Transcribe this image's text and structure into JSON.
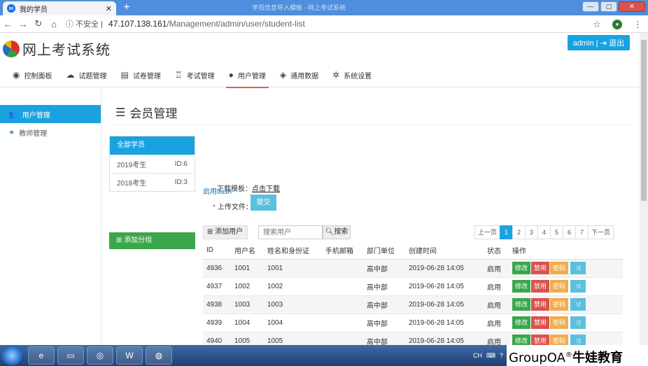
{
  "browser": {
    "tab_title": "我的学员",
    "window_title": "学员信息导入模板 - 网上考试系统",
    "url_warning": "不安全",
    "url_host": "47.107.138.161",
    "url_path": "/Management/admin/user/student-list"
  },
  "header": {
    "app_title": "网上考试系统",
    "admin_label": "admin",
    "logout_label": "退出"
  },
  "main_nav": [
    {
      "label": "控制面板",
      "icon": "dashboard-icon"
    },
    {
      "label": "试题管理",
      "icon": "cloud-icon"
    },
    {
      "label": "试卷管理",
      "icon": "file-icon"
    },
    {
      "label": "考试管理",
      "icon": "trophy-icon"
    },
    {
      "label": "用户管理",
      "icon": "user-icon",
      "active": true
    },
    {
      "label": "通用数据",
      "icon": "cubes-icon"
    },
    {
      "label": "系统设置",
      "icon": "gear-icon"
    }
  ],
  "sidebar": {
    "items": [
      {
        "label": "用户管理",
        "active": true
      },
      {
        "label": "教师管理",
        "active": false
      }
    ]
  },
  "content": {
    "heading": "会员管理",
    "groups": {
      "header": "全部学员",
      "rows": [
        {
          "name": "2019考生",
          "id": "ID:6"
        },
        {
          "name": "2018考生",
          "id": "ID:3"
        }
      ],
      "add_label": "添加分组"
    },
    "upload": {
      "template_label": "下载模板：",
      "template_link": "点击下载",
      "file_label": "上传文件：",
      "flash_link": "启用flash",
      "submit_label": "提交"
    },
    "toolbar": {
      "add_user": "添加用户",
      "search_placeholder": "搜索用户",
      "search_button": "搜索"
    },
    "pager": [
      "上一页",
      "1",
      "2",
      "3",
      "4",
      "5",
      "6",
      "7",
      "下一页"
    ],
    "table": {
      "headers": [
        "ID",
        "用户名",
        "姓名和身份证",
        "手机邮箱",
        "部门单位",
        "创建时间",
        "状态",
        "操作"
      ],
      "rows": [
        {
          "id": "4936",
          "username": "1001",
          "name": "1001",
          "contact": "",
          "dept": "高中部",
          "created": "2019-06-28 14:05",
          "status": "启用"
        },
        {
          "id": "4937",
          "username": "1002",
          "name": "1002",
          "contact": "",
          "dept": "高中部",
          "created": "2019-06-28 14:05",
          "status": "启用"
        },
        {
          "id": "4938",
          "username": "1003",
          "name": "1003",
          "contact": "",
          "dept": "高中部",
          "created": "2019-06-28 14:05",
          "status": "启用"
        },
        {
          "id": "4939",
          "username": "1004",
          "name": "1004",
          "contact": "",
          "dept": "高中部",
          "created": "2019-06-28 14:05",
          "status": "启用"
        },
        {
          "id": "4940",
          "username": "1005",
          "name": "1005",
          "contact": "",
          "dept": "高中部",
          "created": "2019-06-28 14:05",
          "status": "启用"
        }
      ],
      "actions": {
        "edit": "修改",
        "ban": "禁用",
        "password": "密码"
      }
    }
  },
  "taskbar": {
    "tray_text": "CH",
    "watermark": "GroupOA",
    "watermark_mark": "®",
    "watermark_cn": "牛娃教育"
  },
  "colors": {
    "primary": "#1aa2e0",
    "success": "#3aa74a",
    "danger": "#d9534f",
    "warning": "#f0ad4e",
    "info": "#5bc0de"
  }
}
